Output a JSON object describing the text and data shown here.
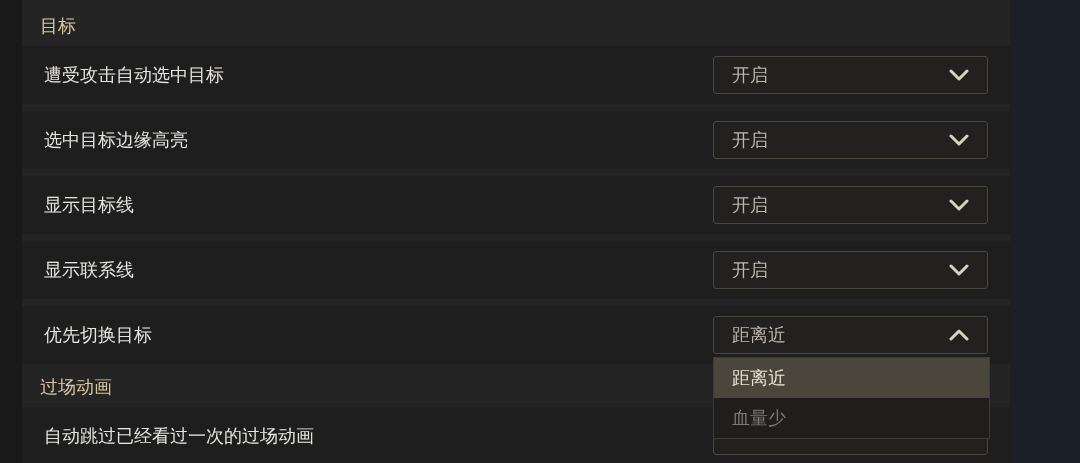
{
  "sections": [
    {
      "title": "目标",
      "rows": [
        {
          "label": "遭受攻击自动选中目标",
          "value": "开启",
          "expanded": false
        },
        {
          "label": "选中目标边缘高亮",
          "value": "开启",
          "expanded": false
        },
        {
          "label": "显示目标线",
          "value": "开启",
          "expanded": false
        },
        {
          "label": "显示联系线",
          "value": "开启",
          "expanded": false
        },
        {
          "label": "优先切换目标",
          "value": "距离近",
          "expanded": true,
          "options": [
            {
              "label": "距离近",
              "selected": true
            },
            {
              "label": "血量少",
              "selected": false
            }
          ]
        }
      ]
    },
    {
      "title": "过场动画",
      "rows": [
        {
          "label": "自动跳过已经看过一次的过场动画",
          "expanded": false
        }
      ]
    }
  ]
}
